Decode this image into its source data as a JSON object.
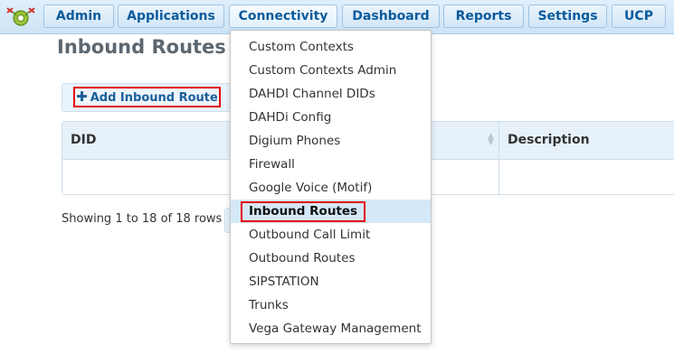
{
  "nav": {
    "items": [
      {
        "label": "Admin"
      },
      {
        "label": "Applications"
      },
      {
        "label": "Connectivity"
      },
      {
        "label": "Dashboard"
      },
      {
        "label": "Reports"
      },
      {
        "label": "Settings"
      },
      {
        "label": "UCP"
      }
    ]
  },
  "page": {
    "title": "Inbound Routes"
  },
  "toolbar": {
    "add_label": "Add Inbound Route",
    "add_icon": "plus-icon"
  },
  "table": {
    "columns": [
      "DID",
      "Description"
    ],
    "info": "Showing 1 to 18 of 18 rows"
  },
  "dropdown": {
    "items": [
      {
        "label": "Custom Contexts"
      },
      {
        "label": "Custom Contexts Admin"
      },
      {
        "label": "DAHDI Channel DIDs"
      },
      {
        "label": "DAHDi Config"
      },
      {
        "label": "Digium Phones"
      },
      {
        "label": "Firewall"
      },
      {
        "label": "Google Voice (Motif)"
      },
      {
        "label": "Inbound Routes"
      },
      {
        "label": "Outbound Call Limit"
      },
      {
        "label": "Outbound Routes"
      },
      {
        "label": "SIPSTATION"
      },
      {
        "label": "Trunks"
      },
      {
        "label": "Vega Gateway Management"
      }
    ],
    "selected": "Inbound Routes"
  },
  "colors": {
    "accent": "#0b5b9c",
    "highlight_border": "#e3000f",
    "highlight_bg": "#d5e8f7"
  }
}
